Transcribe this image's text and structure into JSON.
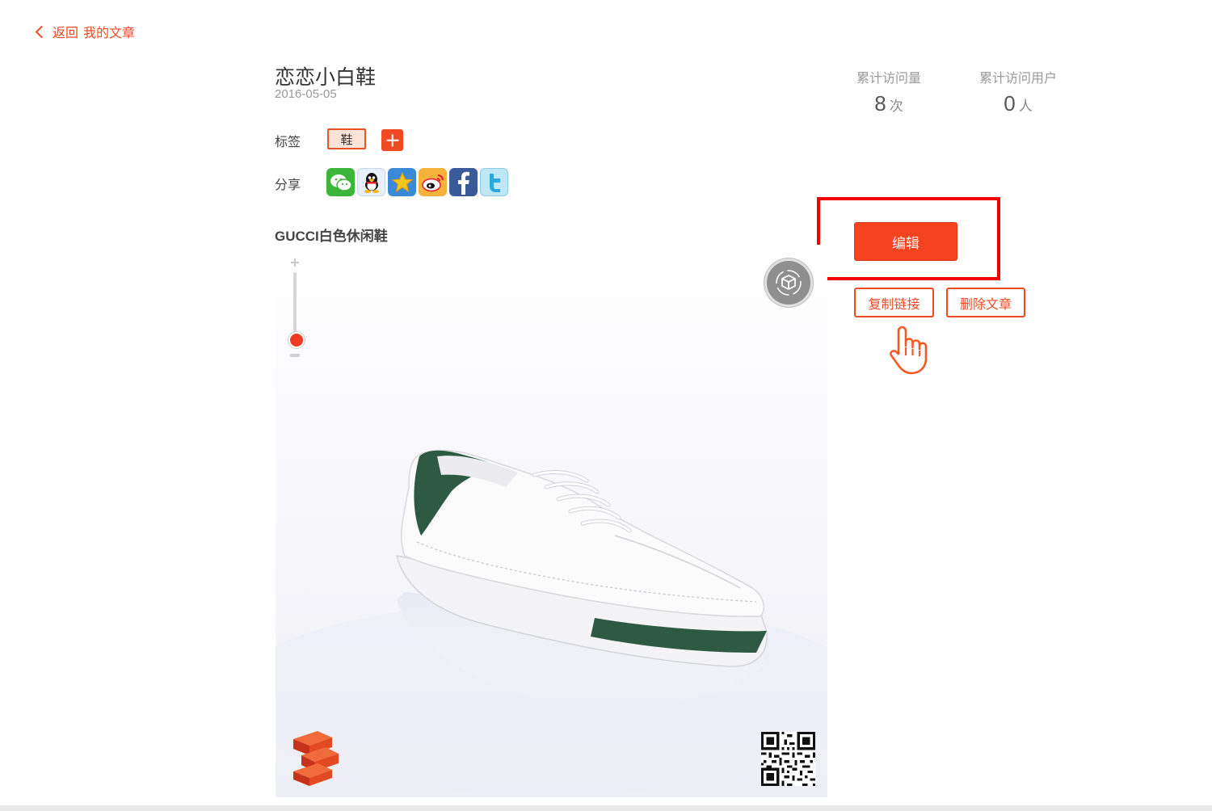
{
  "nav": {
    "back_label": "返回",
    "breadcrumb": "我的文章"
  },
  "article": {
    "title": "恋恋小白鞋",
    "date": "2016-05-05",
    "tag_label": "标签",
    "tags": [
      "鞋"
    ],
    "share_label": "分享",
    "share_icons": [
      "wechat-icon",
      "qq-icon",
      "qzone-icon",
      "weibo-icon",
      "facebook-icon",
      "twitter-icon"
    ],
    "model_title": "GUCCI白色休闲鞋"
  },
  "stats": {
    "visits_label": "累计访问量",
    "visits_value": "8",
    "visits_unit": "次",
    "users_label": "累计访问用户",
    "users_value": "0",
    "users_unit": "人"
  },
  "actions": {
    "edit_label": "编辑",
    "copy_link_label": "复制链接",
    "delete_label": "删除文章"
  },
  "colors": {
    "accent": "#f04a24",
    "highlight": "#f20000",
    "shoe_accent": "#2e5a43"
  },
  "viewer": {
    "zoom_level": 0.0
  }
}
